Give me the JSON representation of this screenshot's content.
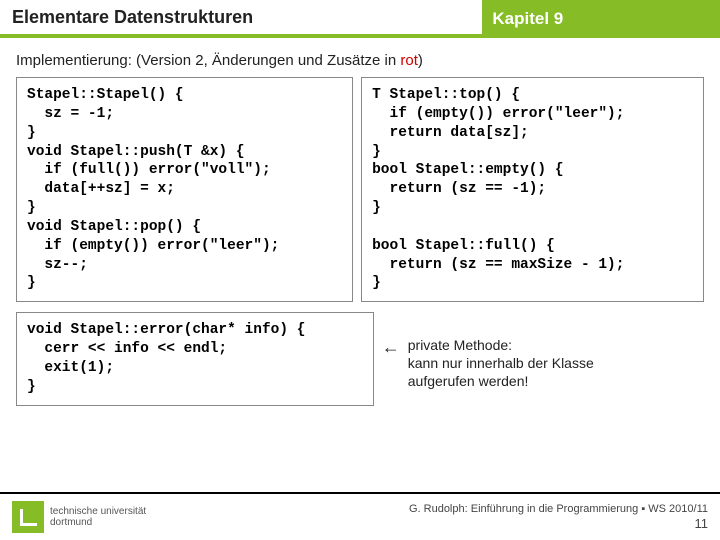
{
  "header": {
    "title": "Elementare Datenstrukturen",
    "chapter": "Kapitel 9"
  },
  "subtitle": {
    "prefix": "Implementierung: (Version 2, Änderungen und Zusätze in ",
    "highlight": "rot",
    "suffix": ")"
  },
  "code": {
    "left": "Stapel::Stapel() {\n  sz = -1;\n}\nvoid Stapel::push(T &x) {\n  if (full()) error(\"voll\");\n  data[++sz] = x;\n}\nvoid Stapel::pop() {\n  if (empty()) error(\"leer\");\n  sz--;\n}",
    "right": "T Stapel::top() {\n  if (empty()) error(\"leer\");\n  return data[sz];\n}\nbool Stapel::empty() {\n  return (sz == -1);\n}\n\nbool Stapel::full() {\n  return (sz == maxSize - 1);\n}",
    "bottom": "void Stapel::error(char* info) {\n  cerr << info << endl;\n  exit(1);\n}"
  },
  "annotation": {
    "arrow": "←",
    "line1": "private Methode:",
    "line2": "kann nur innerhalb der Klasse",
    "line3": "aufgerufen werden!"
  },
  "footer": {
    "uni1": "technische universität",
    "uni2": "dortmund",
    "credit": "G. Rudolph: Einführung in die Programmierung ▪ WS 2010/11",
    "page": "11"
  }
}
